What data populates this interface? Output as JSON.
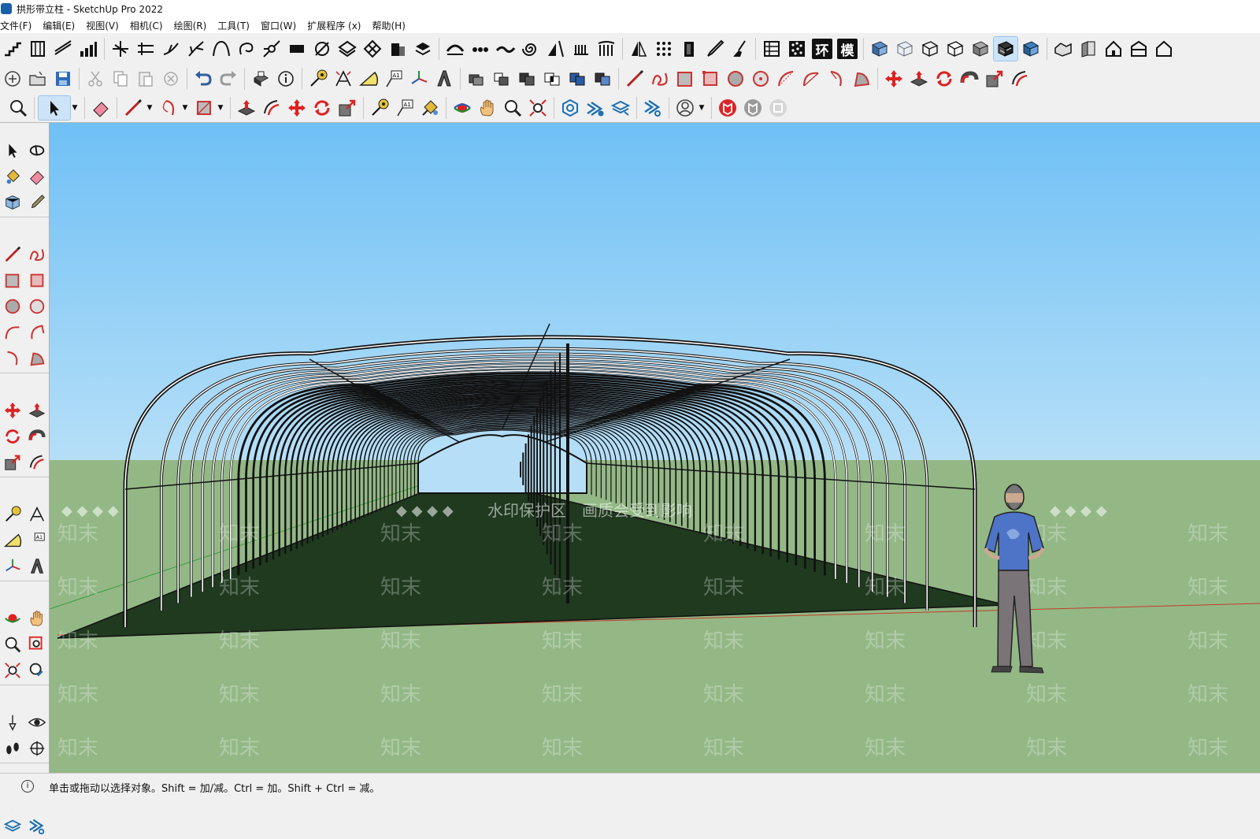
{
  "window": {
    "title": "拱形带立柱 - SketchUp Pro 2022"
  },
  "menu": [
    {
      "label": "文件(F)"
    },
    {
      "label": "编辑(E)"
    },
    {
      "label": "视图(V)"
    },
    {
      "label": "相机(C)"
    },
    {
      "label": "绘图(R)"
    },
    {
      "label": "工具(T)"
    },
    {
      "label": "窗口(W)"
    },
    {
      "label": "扩展程序 (x)"
    },
    {
      "label": "帮助(H)"
    }
  ],
  "toolbar": {
    "glyph_buttons": {
      "huan": "环",
      "mo": "模"
    },
    "active_tool": "select"
  },
  "viewport": {
    "watermark_primary": "水印保护区　画质会受到影响",
    "watermark_brand": "知末",
    "diamond_row": "◆ ◆ ◆ ◆",
    "sky_top": "#6fc0f6",
    "sky_bottom": "#b6dff7",
    "ground": "#93b886",
    "floor": "#1f3a1f",
    "axis_red": "#c43b2a",
    "axis_green": "#3c9a3c"
  },
  "status": {
    "text": "单击或拖动以选择对象。Shift = 加/减。Ctrl = 加。Shift + Ctrl = 减。"
  }
}
